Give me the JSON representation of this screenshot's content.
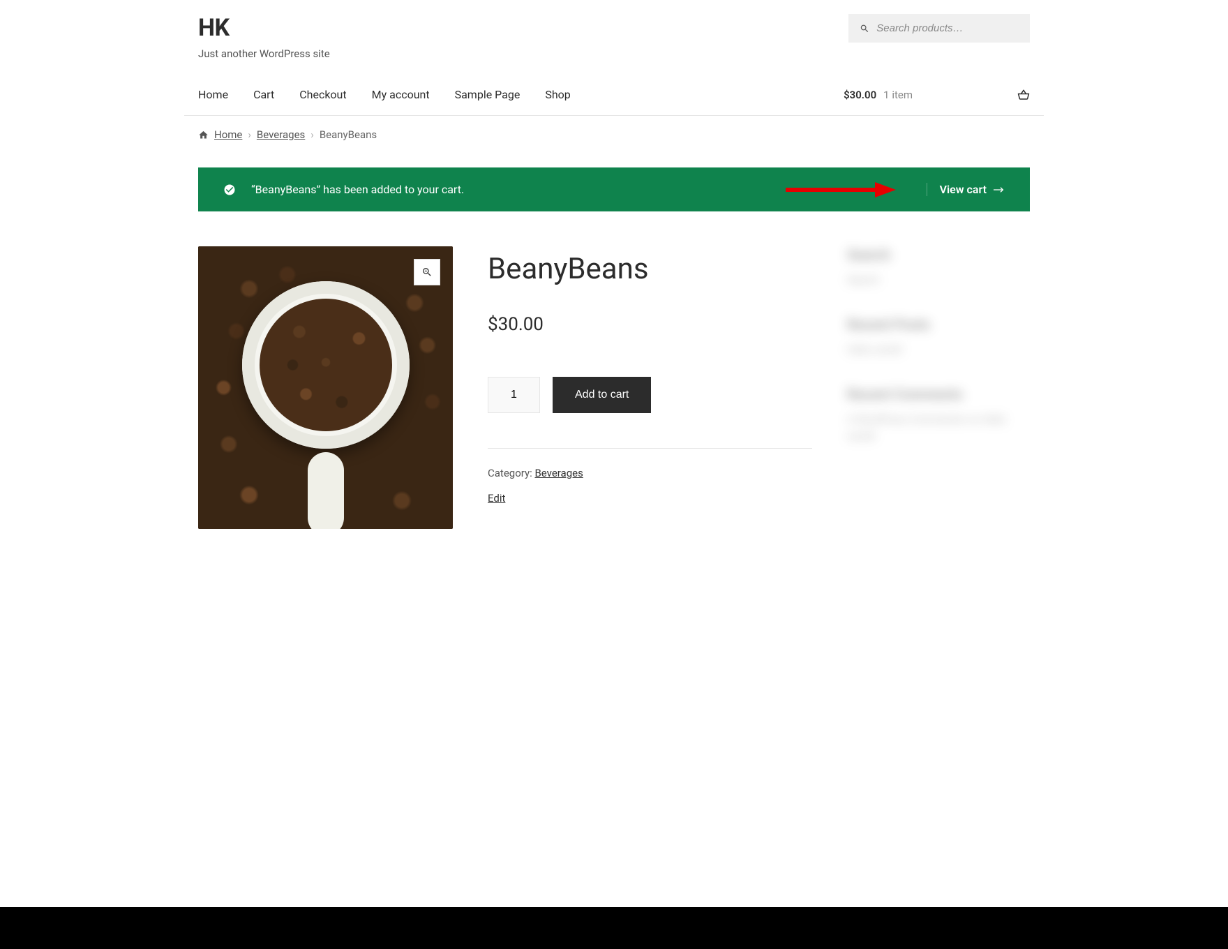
{
  "site": {
    "title": "HK",
    "tagline": "Just another WordPress site"
  },
  "search": {
    "placeholder": "Search products…"
  },
  "nav": {
    "items": [
      "Home",
      "Cart",
      "Checkout",
      "My account",
      "Sample Page",
      "Shop"
    ]
  },
  "cart_summary": {
    "price": "$30.00",
    "items": "1 item"
  },
  "breadcrumb": {
    "home": "Home",
    "category": "Beverages",
    "current": "BeanyBeans"
  },
  "notice": {
    "message": "“BeanyBeans” has been added to your cart.",
    "view_cart": "View cart"
  },
  "product": {
    "title": "BeanyBeans",
    "price": "$30.00",
    "quantity": "1",
    "add_to_cart": "Add to cart",
    "category_label": "Category: ",
    "category": "Beverages",
    "edit": "Edit"
  },
  "sidebar": {
    "search_title": "Search",
    "search_btn": "Search",
    "recent_posts": "Recent Posts",
    "recent_post_item": "Hello world!",
    "recent_comments": "Recent Comments",
    "recent_comment_item": "A WordPress Commenter on Hello world!"
  }
}
